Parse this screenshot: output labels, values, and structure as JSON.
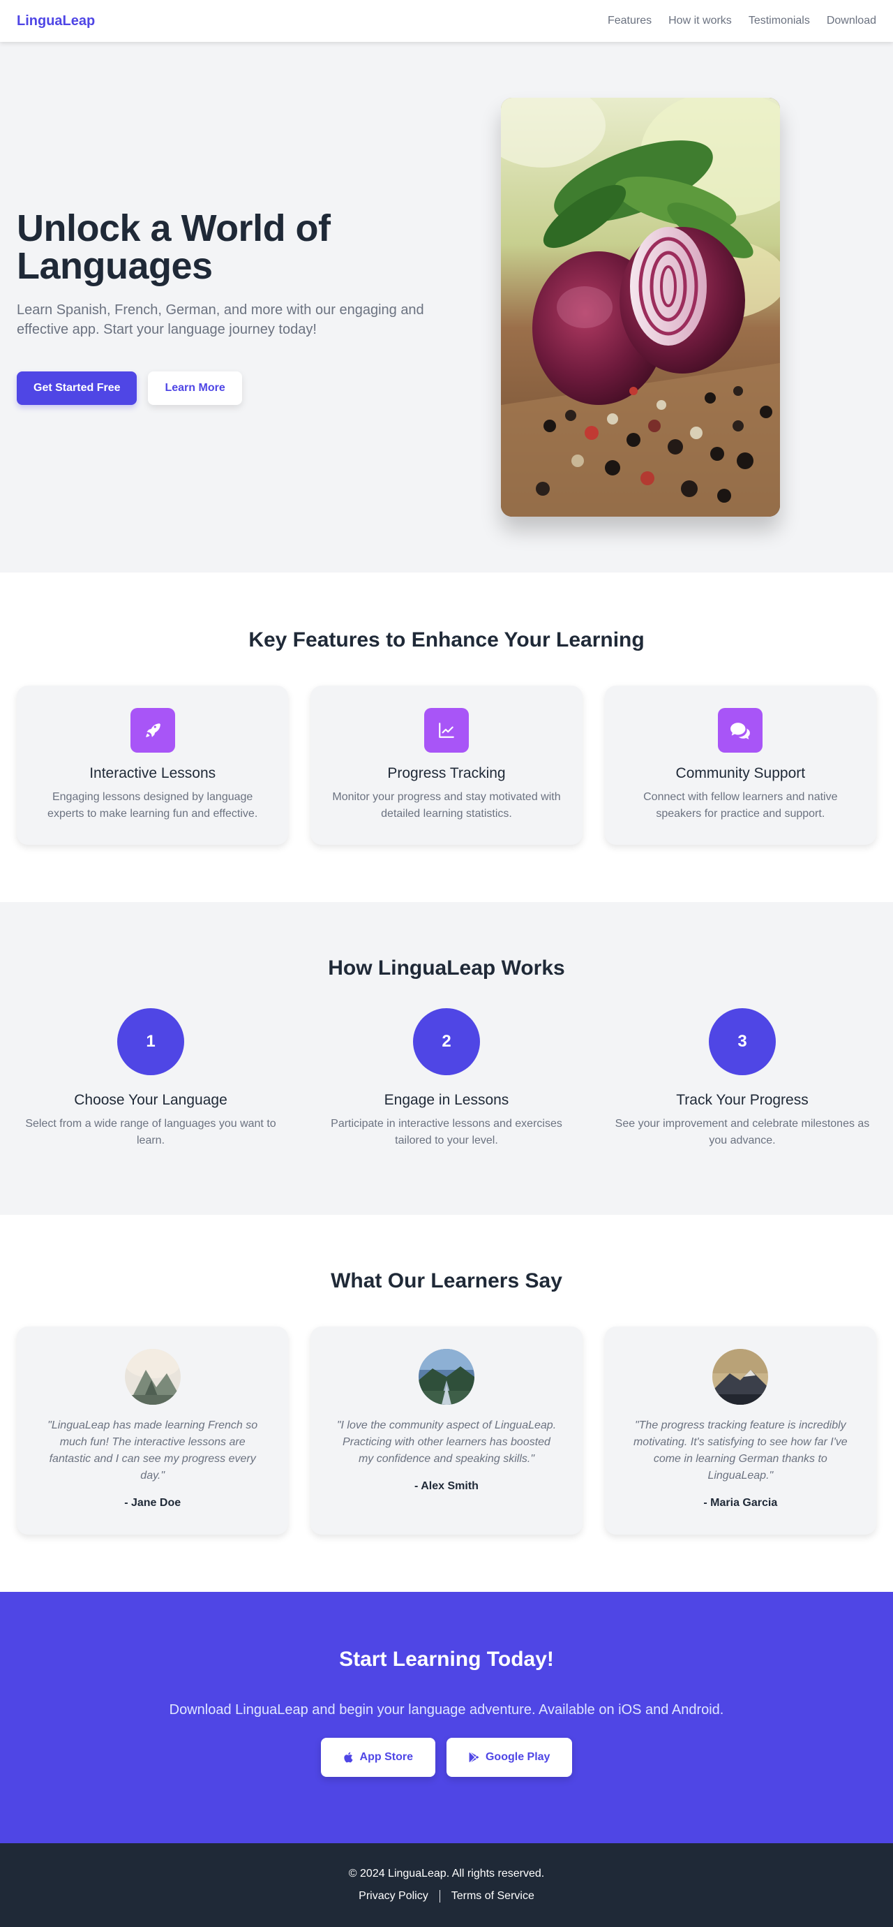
{
  "nav": {
    "brand": "LinguaLeap",
    "links": [
      "Features",
      "How it works",
      "Testimonials",
      "Download"
    ]
  },
  "hero": {
    "title": "Unlock a World of Languages",
    "subtitle": "Learn Spanish, French, German, and more with our engaging and effective app. Start your language journey today!",
    "primary_cta": "Get Started Free",
    "secondary_cta": "Learn More",
    "image_icon": "onions-peppercorns-photo"
  },
  "features": {
    "title": "Key Features to Enhance Your Learning",
    "items": [
      {
        "icon": "rocket-icon",
        "title": "Interactive Lessons",
        "desc": "Engaging lessons designed by language experts to make learning fun and effective."
      },
      {
        "icon": "chart-line-icon",
        "title": "Progress Tracking",
        "desc": "Monitor your progress and stay motivated with detailed learning statistics."
      },
      {
        "icon": "comments-icon",
        "title": "Community Support",
        "desc": "Connect with fellow learners and native speakers for practice and support."
      }
    ]
  },
  "how": {
    "title": "How LinguaLeap Works",
    "steps": [
      {
        "num": "1",
        "title": "Choose Your Language",
        "desc": "Select from a wide range of languages you want to learn."
      },
      {
        "num": "2",
        "title": "Engage in Lessons",
        "desc": "Participate in interactive lessons and exercises tailored to your level."
      },
      {
        "num": "3",
        "title": "Track Your Progress",
        "desc": "See your improvement and celebrate milestones as you advance."
      }
    ]
  },
  "testimonials": {
    "title": "What Our Learners Say",
    "items": [
      {
        "quote": "\"LinguaLeap has made learning French so much fun! The interactive lessons are fantastic and I can see my progress every day.\"",
        "author": "- Jane Doe"
      },
      {
        "quote": "\"I love the community aspect of LinguaLeap. Practicing with other learners has boosted my confidence and speaking skills.\"",
        "author": "- Alex Smith"
      },
      {
        "quote": "\"The progress tracking feature is incredibly motivating. It's satisfying to see how far I've come in learning German thanks to LinguaLeap.\"",
        "author": "- Maria Garcia"
      }
    ]
  },
  "cta": {
    "title": "Start Learning Today!",
    "subtitle": "Download LinguaLeap and begin your language adventure. Available on iOS and Android.",
    "app_store": "App Store",
    "google_play": "Google Play"
  },
  "footer": {
    "copyright": "© 2024 LinguaLeap. All rights reserved.",
    "privacy": "Privacy Policy",
    "terms": "Terms of Service"
  },
  "colors": {
    "accent": "#4f46e5",
    "feature_icon_bg": "#a855f7",
    "footer_bg": "#1f2937"
  }
}
